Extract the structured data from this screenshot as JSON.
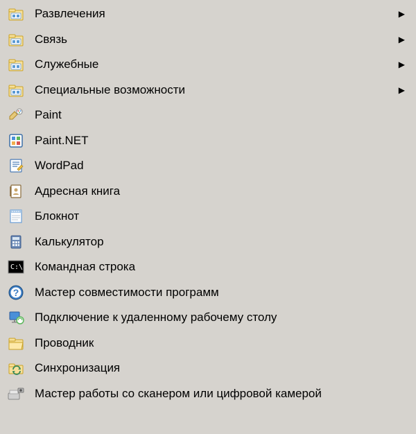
{
  "menu": {
    "items": [
      {
        "id": "entertainment",
        "label": "Развлечения",
        "icon": "folder-group-icon",
        "submenu": true
      },
      {
        "id": "communication",
        "label": "Связь",
        "icon": "folder-group-icon",
        "submenu": true
      },
      {
        "id": "system-tools",
        "label": "Служебные",
        "icon": "folder-group-icon",
        "submenu": true
      },
      {
        "id": "accessibility",
        "label": "Специальные возможности",
        "icon": "folder-group-icon",
        "submenu": true
      },
      {
        "id": "paint",
        "label": "Paint",
        "icon": "paint-icon",
        "submenu": false
      },
      {
        "id": "paint-net",
        "label": "Paint.NET",
        "icon": "paint-net-icon",
        "submenu": false
      },
      {
        "id": "wordpad",
        "label": "WordPad",
        "icon": "wordpad-icon",
        "submenu": false
      },
      {
        "id": "address-book",
        "label": "Адресная книга",
        "icon": "address-book-icon",
        "submenu": false
      },
      {
        "id": "notepad",
        "label": "Блокнот",
        "icon": "notepad-icon",
        "submenu": false
      },
      {
        "id": "calculator",
        "label": "Калькулятор",
        "icon": "calculator-icon",
        "submenu": false
      },
      {
        "id": "cmd",
        "label": "Командная строка",
        "icon": "cmd-icon",
        "submenu": false
      },
      {
        "id": "compat-wizard",
        "label": "Мастер совместимости программ",
        "icon": "help-icon",
        "submenu": false
      },
      {
        "id": "remote-desktop",
        "label": "Подключение к удаленному рабочему столу",
        "icon": "remote-desktop-icon",
        "submenu": false
      },
      {
        "id": "explorer",
        "label": "Проводник",
        "icon": "explorer-icon",
        "submenu": false
      },
      {
        "id": "sync",
        "label": "Синхронизация",
        "icon": "sync-icon",
        "submenu": false
      },
      {
        "id": "scanner-camera",
        "label": "Мастер работы со сканером или цифровой камерой",
        "icon": "scanner-icon",
        "submenu": false
      }
    ]
  },
  "icons": {
    "folder-group-icon": "folder-group",
    "paint-icon": "paint",
    "paint-net-icon": "paint-net",
    "wordpad-icon": "wordpad",
    "address-book-icon": "address-book",
    "notepad-icon": "notepad",
    "calculator-icon": "calculator",
    "cmd-icon": "cmd",
    "help-icon": "help",
    "remote-desktop-icon": "remote-desktop",
    "explorer-icon": "explorer",
    "sync-icon": "sync",
    "scanner-icon": "scanner"
  }
}
